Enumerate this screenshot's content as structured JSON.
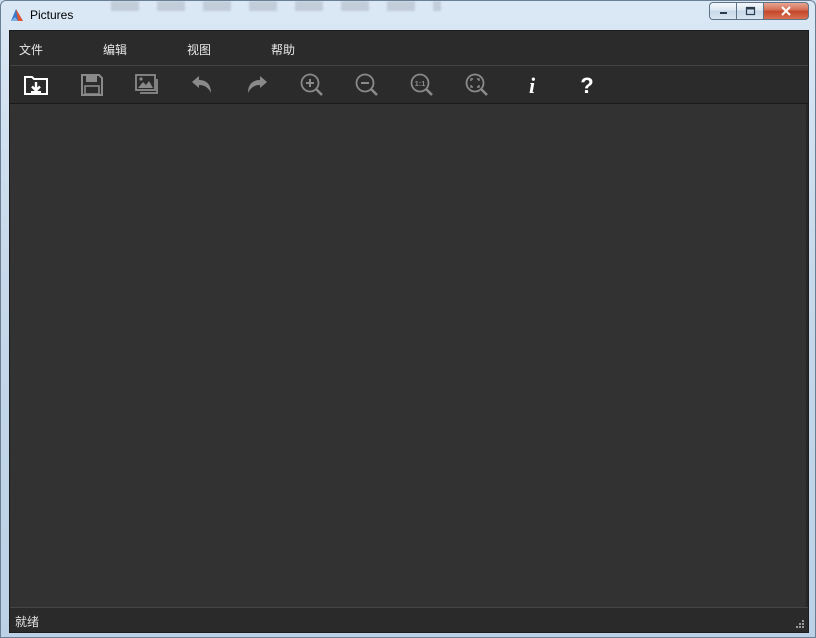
{
  "window": {
    "title": "Pictures",
    "app_icon": "pictures-app-icon",
    "controls": {
      "minimize_icon": "minimize-icon",
      "maximize_icon": "maximize-icon",
      "close_icon": "close-icon"
    }
  },
  "menu": {
    "items": [
      {
        "id": "file",
        "label": "文件"
      },
      {
        "id": "edit",
        "label": "编辑"
      },
      {
        "id": "view",
        "label": "视图"
      },
      {
        "id": "help",
        "label": "帮助"
      }
    ]
  },
  "toolbar": {
    "buttons": [
      {
        "id": "open",
        "icon": "open-folder-icon",
        "enabled": true
      },
      {
        "id": "save",
        "icon": "save-icon",
        "enabled": false
      },
      {
        "id": "gallery",
        "icon": "image-gallery-icon",
        "enabled": false
      },
      {
        "id": "undo",
        "icon": "undo-icon",
        "enabled": false
      },
      {
        "id": "redo",
        "icon": "redo-icon",
        "enabled": false
      },
      {
        "id": "zoom-in",
        "icon": "zoom-in-icon",
        "enabled": false
      },
      {
        "id": "zoom-out",
        "icon": "zoom-out-icon",
        "enabled": false
      },
      {
        "id": "actual-size",
        "icon": "actual-size-icon",
        "label": "1:1",
        "enabled": false
      },
      {
        "id": "fit",
        "icon": "fit-to-window-icon",
        "enabled": false
      },
      {
        "id": "info",
        "icon": "info-icon",
        "label": "i",
        "enabled": true
      },
      {
        "id": "help",
        "icon": "help-icon",
        "label": "?",
        "enabled": true
      }
    ]
  },
  "status": {
    "text": "就绪"
  },
  "colors": {
    "client_bg": "#2d2d2d",
    "canvas_bg": "#323232",
    "icon_enabled": "#ffffff",
    "icon_disabled": "#8a8a8a",
    "close_button": "#c3452a"
  }
}
